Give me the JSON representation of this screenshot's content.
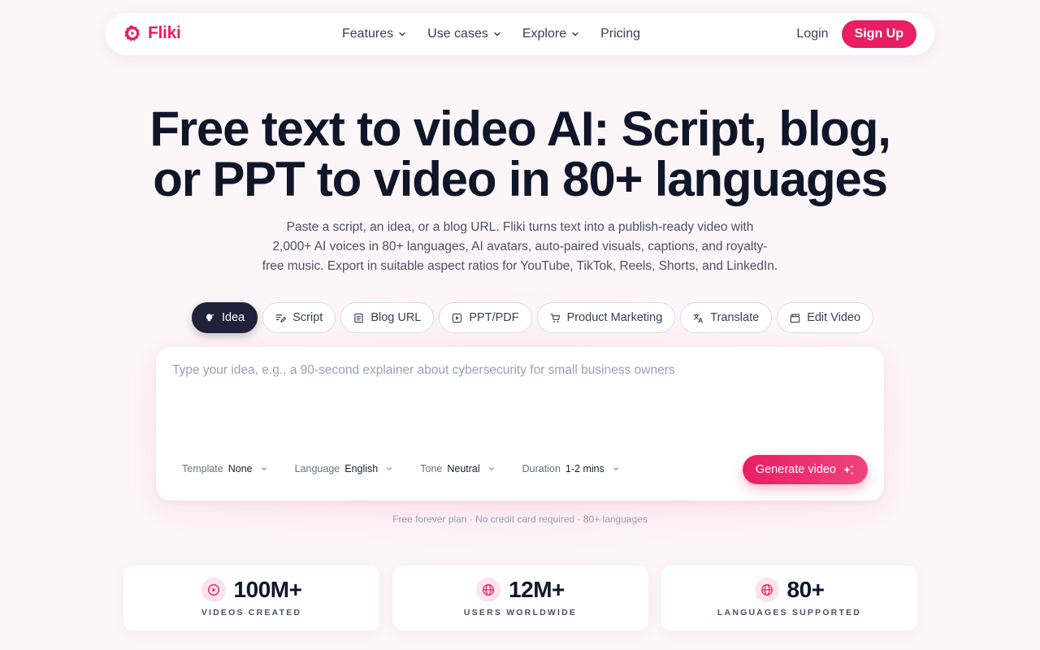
{
  "brand": {
    "name": "Fliki",
    "accent": "#e91e63",
    "dark": "#1f2239"
  },
  "nav": {
    "items": [
      {
        "label": "Features",
        "dropdown": true
      },
      {
        "label": "Use cases",
        "dropdown": true
      },
      {
        "label": "Explore",
        "dropdown": true
      },
      {
        "label": "Pricing",
        "dropdown": false
      }
    ],
    "login": "Login",
    "signup": "Sign Up"
  },
  "hero": {
    "title_line1": "Free text to video AI: Script, blog,",
    "title_line2": "or PPT to video in 80+ languages",
    "subtitle_line1": "Paste a script, an idea, or a blog URL. Fliki turns text into a publish-ready video with",
    "subtitle_line2": "2,000+ AI voices in 80+ languages, AI avatars, auto-paired visuals, captions, and royalty-",
    "subtitle_line3": "free music. Export in suitable aspect ratios for YouTube, TikTok, Reels, Shorts, and LinkedIn."
  },
  "tabs": [
    {
      "label": "Idea",
      "icon": "lightbulb-icon",
      "active": true
    },
    {
      "label": "Script",
      "icon": "script-edit-icon",
      "active": false
    },
    {
      "label": "Blog URL",
      "icon": "document-icon",
      "active": false
    },
    {
      "label": "PPT/PDF",
      "icon": "play-box-icon",
      "active": false
    },
    {
      "label": "Product Marketing",
      "icon": "cart-icon",
      "active": false
    },
    {
      "label": "Translate",
      "icon": "translate-icon",
      "active": false
    },
    {
      "label": "Edit Video",
      "icon": "clapperboard-icon",
      "active": false
    }
  ],
  "composer": {
    "placeholder": "Type your idea, e.g., a 90-second explainer about cybersecurity for small business owners",
    "value": "",
    "options": [
      {
        "key": "Template",
        "value": "None"
      },
      {
        "key": "Language",
        "value": "English"
      },
      {
        "key": "Tone",
        "value": "Neutral"
      },
      {
        "key": "Duration",
        "value": "1-2 mins"
      }
    ],
    "generate_label": "Generate video"
  },
  "fine_print": "Free forever plan · No credit card required · 80+ languages",
  "stats": [
    {
      "value": "100M+",
      "label": "VIDEOS CREATED",
      "icon": "play-circle-icon"
    },
    {
      "value": "12M+",
      "label": "USERS WORLDWIDE",
      "icon": "globe-icon"
    },
    {
      "value": "80+",
      "label": "LANGUAGES SUPPORTED",
      "icon": "globe-icon"
    }
  ]
}
